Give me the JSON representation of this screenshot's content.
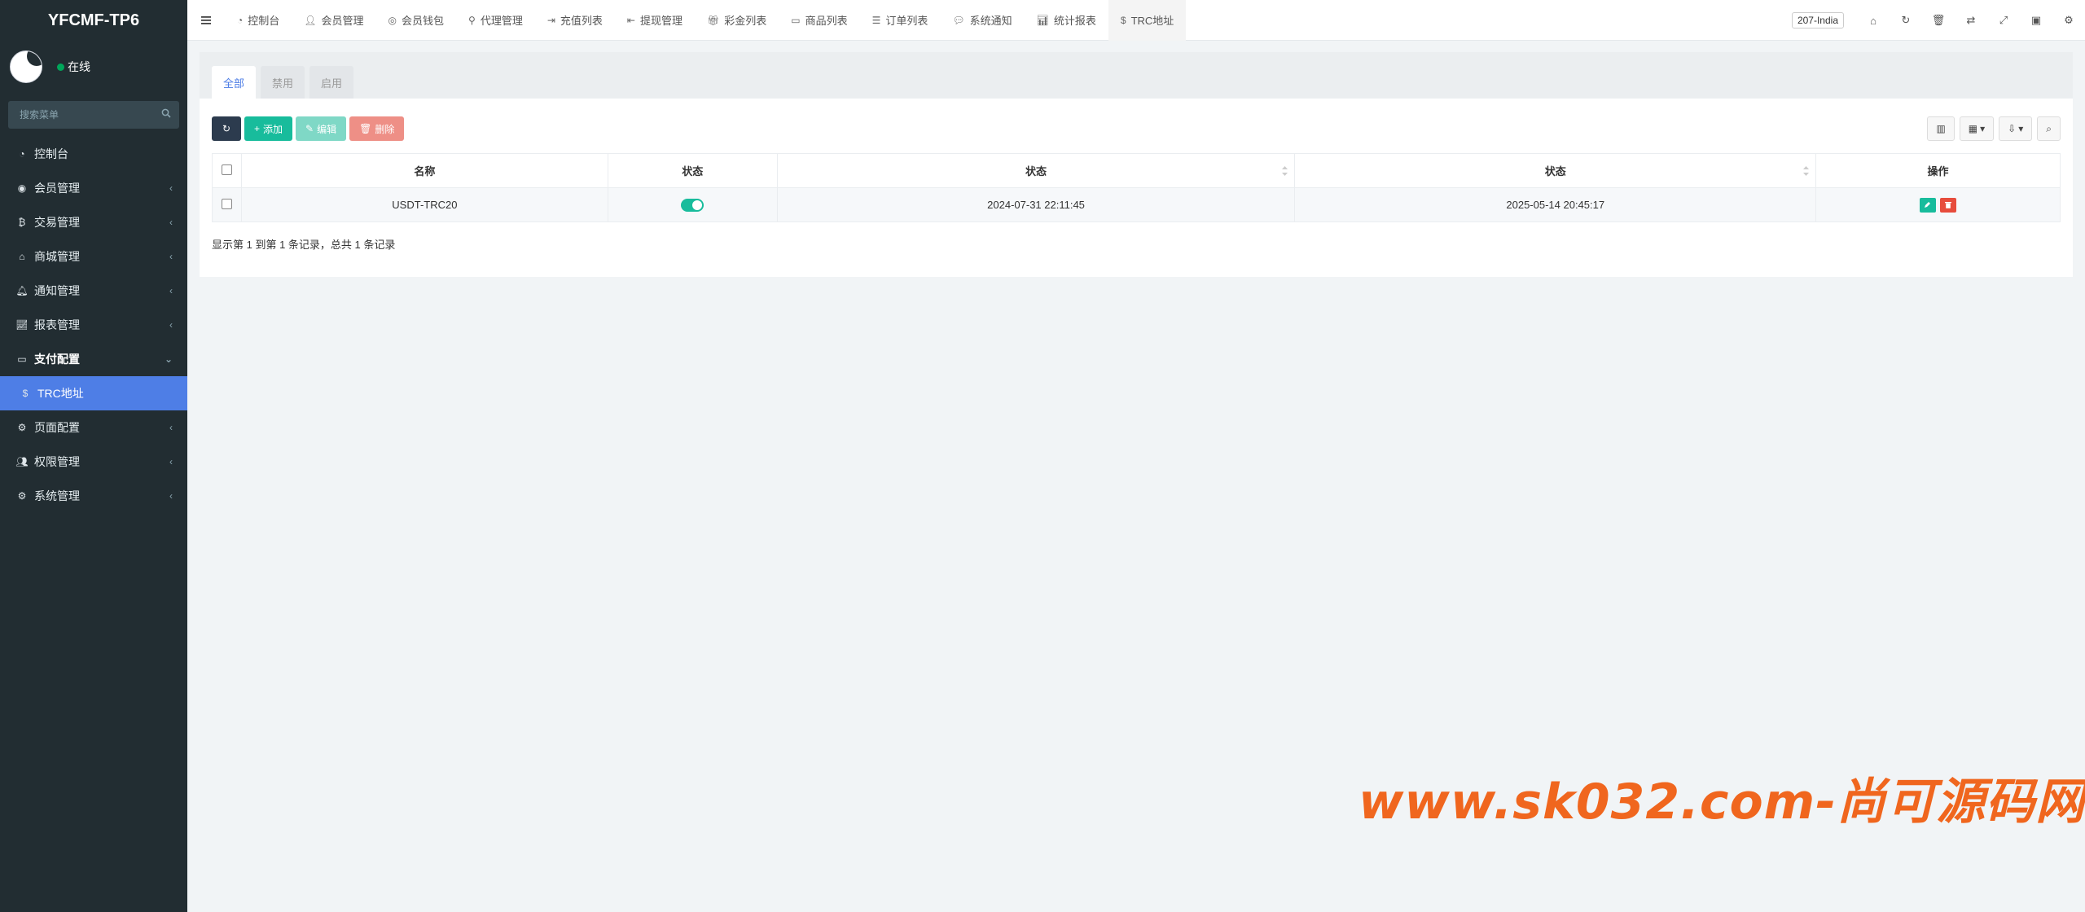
{
  "sidebar": {
    "brand": "YFCMF-TP6",
    "status": "在线",
    "search_placeholder": "搜索菜单",
    "items": [
      {
        "label": "控制台",
        "icon": "dashboard-icon"
      },
      {
        "label": "会员管理",
        "icon": "user-circle-icon"
      },
      {
        "label": "交易管理",
        "icon": "bitcoin-icon"
      },
      {
        "label": "商城管理",
        "icon": "home-icon"
      },
      {
        "label": "通知管理",
        "icon": "bell-icon"
      },
      {
        "label": "报表管理",
        "icon": "line-chart-icon"
      },
      {
        "label": "支付配置",
        "icon": "credit-card-icon"
      },
      {
        "label": "TRC地址",
        "icon": "dollar-icon"
      },
      {
        "label": "页面配置",
        "icon": "gear-icon"
      },
      {
        "label": "权限管理",
        "icon": "users-icon"
      },
      {
        "label": "系统管理",
        "icon": "cogs-icon"
      }
    ]
  },
  "topbar": {
    "tabs": [
      {
        "label": "控制台",
        "icon": "dashboard-icon"
      },
      {
        "label": "会员管理",
        "icon": "user-icon"
      },
      {
        "label": "会员钱包",
        "icon": "wallet-icon"
      },
      {
        "label": "代理管理",
        "icon": "sitemap-icon"
      },
      {
        "label": "充值列表",
        "icon": "sign-in-icon"
      },
      {
        "label": "提现管理",
        "icon": "sign-out-icon"
      },
      {
        "label": "彩金列表",
        "icon": "gift-icon"
      },
      {
        "label": "商品列表",
        "icon": "desktop-icon"
      },
      {
        "label": "订单列表",
        "icon": "list-icon"
      },
      {
        "label": "系统通知",
        "icon": "comments-icon"
      },
      {
        "label": "统计报表",
        "icon": "bar-chart-icon"
      },
      {
        "label": "TRC地址",
        "icon": "dollar-icon"
      }
    ],
    "lang": "207-India"
  },
  "content": {
    "filter_tabs": [
      "全部",
      "禁用",
      "启用"
    ],
    "toolbar": {
      "add": "添加",
      "edit": "编辑",
      "delete": "删除"
    },
    "table": {
      "headers": [
        "名称",
        "状态",
        "状态",
        "状态",
        "操作"
      ],
      "rows": [
        {
          "name": "USDT-TRC20",
          "enabled": true,
          "created": "2024-07-31 22:11:45",
          "updated": "2025-05-14 20:45:17"
        }
      ]
    },
    "pager_text": "显示第 1 到第 1 条记录，总共 1 条记录"
  },
  "watermark": "www.sk032.com-尚可源码网",
  "colors": {
    "sidebar": "#222d32",
    "active": "#4e7ee6",
    "success": "#18bc9c",
    "danger": "#e74c3c",
    "watermark": "#f0661e"
  }
}
